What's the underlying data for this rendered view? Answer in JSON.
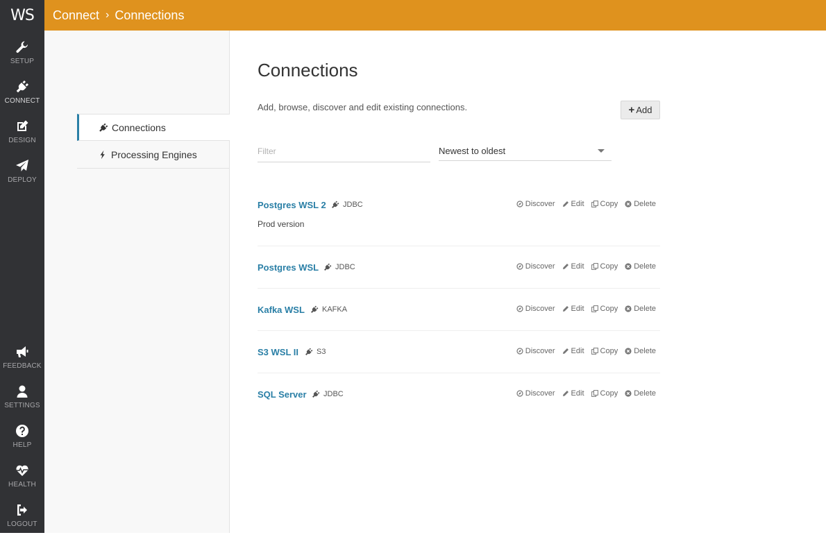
{
  "app": {
    "logo": "WS"
  },
  "colors": {
    "accent": "#df921e",
    "sidebar": "#313235",
    "link": "#2a7fa6"
  },
  "breadcrumb": {
    "parent": "Connect",
    "separator": "›",
    "current": "Connections"
  },
  "nav": {
    "top": [
      {
        "label": "SETUP",
        "icon": "wrench-icon"
      },
      {
        "label": "CONNECT",
        "icon": "plug-icon"
      },
      {
        "label": "DESIGN",
        "icon": "edit-icon"
      },
      {
        "label": "DEPLOY",
        "icon": "paper-plane-icon"
      }
    ],
    "bottom": [
      {
        "label": "FEEDBACK",
        "icon": "megaphone-icon"
      },
      {
        "label": "SETTINGS",
        "icon": "user-icon"
      },
      {
        "label": "HELP",
        "icon": "question-icon"
      },
      {
        "label": "HEALTH",
        "icon": "heartbeat-icon"
      },
      {
        "label": "LOGOUT",
        "icon": "sign-out-icon"
      }
    ]
  },
  "subnav": {
    "items": [
      {
        "label": "Connections",
        "icon": "plug-icon",
        "active": true
      },
      {
        "label": "Processing Engines",
        "icon": "bolt-icon",
        "active": false
      }
    ]
  },
  "main": {
    "title": "Connections",
    "description": "Add, browse, discover and edit existing connections.",
    "add_label": "Add",
    "filter_placeholder": "Filter",
    "sort_value": "Newest to oldest"
  },
  "actions": {
    "discover": "Discover",
    "edit": "Edit",
    "copy": "Copy",
    "delete": "Delete"
  },
  "connections": [
    {
      "name": "Postgres WSL 2",
      "type": "JDBC",
      "description": "Prod version"
    },
    {
      "name": "Postgres WSL",
      "type": "JDBC",
      "description": ""
    },
    {
      "name": "Kafka WSL",
      "type": "KAFKA",
      "description": ""
    },
    {
      "name": "S3 WSL II",
      "type": "S3",
      "description": ""
    },
    {
      "name": "SQL Server",
      "type": "JDBC",
      "description": ""
    }
  ]
}
